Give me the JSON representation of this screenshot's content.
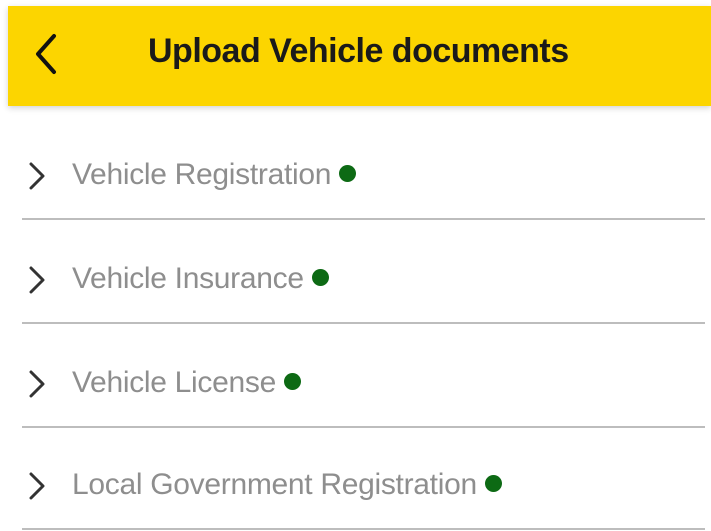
{
  "header": {
    "title": "Upload Vehicle documents",
    "back_icon": "chevron-left-icon",
    "background": "#FCD500"
  },
  "documents": [
    {
      "label": "Vehicle Registration",
      "status_color": "#0d6a14"
    },
    {
      "label": "Vehicle Insurance",
      "status_color": "#0d6a14"
    },
    {
      "label": "Vehicle License",
      "status_color": "#0d6a14"
    },
    {
      "label": "Local Government Registration",
      "status_color": "#0d6a14"
    }
  ],
  "icons": {
    "row_icon": "chevron-right-icon",
    "status_icon": "status-dot-icon"
  }
}
